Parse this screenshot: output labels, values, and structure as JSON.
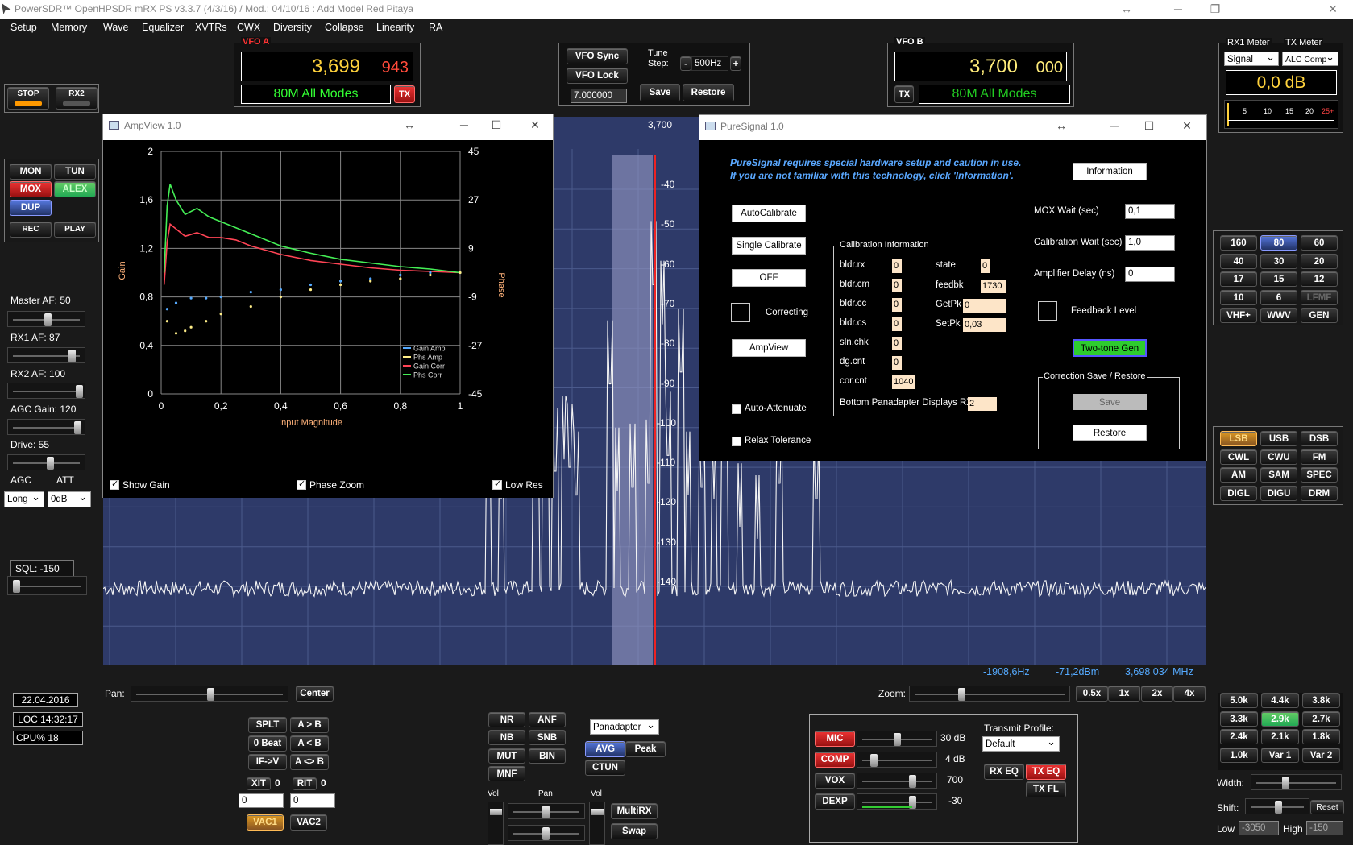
{
  "titlebar": {
    "title": "PowerSDR™ OpenHPSDR mRX PS v3.3.7 (4/3/16) / Mod.: 04/10/16 : Add Model Red Pitaya",
    "resize_glyph": "↔"
  },
  "menu": [
    "Setup",
    "Memory",
    "Wave",
    "Equalizer",
    "XVTRs",
    "CWX",
    "Diversity",
    "Collapse",
    "Linearity",
    "RA"
  ],
  "power": {
    "stop": "STOP",
    "rx2": "RX2"
  },
  "modebtns": {
    "mon": "MON",
    "tun": "TUN",
    "mox": "MOX",
    "alex": "ALEX",
    "dup": "DUP",
    "rec": "REC",
    "play": "PLAY"
  },
  "vfo_a": {
    "label": "VFO A",
    "freq_main": "3,699",
    "freq_sub": "943",
    "band": "80M All Modes",
    "tx": "TX"
  },
  "vfo_b": {
    "label": "VFO B",
    "freq_main": "3,700",
    "freq_sub": "000",
    "band": "80M All Modes",
    "tx": "TX"
  },
  "vfo_ctl": {
    "sync": "VFO Sync",
    "lock": "VFO Lock",
    "tune_step_label": "Tune Step:",
    "tune_step": "500Hz",
    "minus": "-",
    "plus": "+",
    "freq_box": "7.000000",
    "save": "Save",
    "restore": "Restore"
  },
  "meters": {
    "rx1_label": "RX1 Meter",
    "tx_label": "TX Meter",
    "rx1_sel": "Signal",
    "tx_sel": "ALC Comp",
    "reading": "0,0 dB",
    "scale": [
      "5",
      "10",
      "15",
      "20",
      "25+"
    ]
  },
  "left": {
    "master_af": "Master AF:  50",
    "rx1_af": "RX1 AF:  87",
    "rx2_af": "RX2 AF:  100",
    "agc_gain": "AGC Gain:  120",
    "drive": "Drive:  55",
    "agc": "AGC",
    "att": "ATT",
    "agc_sel": "Long",
    "att_sel": "0dB",
    "sql": "SQL: -150"
  },
  "status": {
    "date": "22.04.2016",
    "loc": "LOC 14:32:17",
    "cpu": "CPU%  18"
  },
  "bands": [
    "160",
    "80",
    "60",
    "40",
    "30",
    "20",
    "17",
    "15",
    "12",
    "10",
    "6",
    "LFMF",
    "VHF+",
    "WWV",
    "GEN"
  ],
  "modes": [
    "LSB",
    "USB",
    "DSB",
    "CWL",
    "CWU",
    "FM",
    "AM",
    "SAM",
    "SPEC",
    "DIGL",
    "DIGU",
    "DRM"
  ],
  "filters": [
    "5.0k",
    "4.4k",
    "3.8k",
    "3.3k",
    "2.9k",
    "2.7k",
    "2.4k",
    "2.1k",
    "1.8k",
    "1.0k",
    "Var 1",
    "Var 2"
  ],
  "filter_ctl": {
    "width": "Width:",
    "shift": "Shift:",
    "reset": "Reset",
    "low": "Low",
    "low_val": "-3050",
    "high": "High",
    "high_val": "-150"
  },
  "display": {
    "center_freq": "3,700",
    "dbm_labels": [
      "-40",
      "-50",
      "-60",
      "-70",
      "-80",
      "-90",
      "-100",
      "-110",
      "-120",
      "-130",
      "-140"
    ],
    "cursor_hz": "-1908,6Hz",
    "cursor_dbm": "-71,2dBm",
    "cursor_mhz": "3,698 034 MHz"
  },
  "pan": {
    "pan": "Pan:",
    "center": "Center",
    "zoom": "Zoom:",
    "z05": "0.5x",
    "z1": "1x",
    "z2": "2x",
    "z4": "4x"
  },
  "vfo_btns": {
    "splt": "SPLT",
    "atob": "A > B",
    "zerobeat": "0 Beat",
    "btoa": "A < B",
    "ifv": "IF->V",
    "swap": "A <> B",
    "xit": "XIT",
    "xit_v": "0",
    "rit": "RIT",
    "rit_v": "0",
    "xit_num": "0",
    "rit_num": "0",
    "vac1": "VAC1",
    "vac2": "VAC2"
  },
  "dsp": {
    "nr": "NR",
    "anf": "ANF",
    "nb": "NB",
    "snb": "SNB",
    "mut": "MUT",
    "bin": "BIN",
    "mnf": "MNF",
    "display_mode": "Panadapter",
    "avg": "AVG",
    "peak": "Peak",
    "ctun": "CTUN",
    "vol": "Vol",
    "pan": "Pan",
    "vol2": "Vol",
    "multirx": "MultiRX",
    "swap": "Swap"
  },
  "tx": {
    "mic": "MIC",
    "mic_val": "30 dB",
    "comp": "COMP",
    "comp_val": "4 dB",
    "vox": "VOX",
    "vox_val": "700",
    "dexp": "DEXP",
    "dexp_val": "-30",
    "profile_label": "Transmit Profile:",
    "profile": "Default",
    "rxeq": "RX EQ",
    "txeq": "TX EQ",
    "txfl": "TX FL"
  },
  "ampview": {
    "title": "AmpView 1.0",
    "yleft": [
      "2",
      "1,6",
      "1,2",
      "0,8",
      "0,4",
      "0"
    ],
    "yright": [
      "45",
      "27",
      "9",
      "-9",
      "-27",
      "-45"
    ],
    "xticks": [
      "0",
      "0,2",
      "0,4",
      "0,6",
      "0,8",
      "1"
    ],
    "ylabel": "Gain",
    "y2label": "Phase",
    "xlabel": "Input Magnitude",
    "legend": [
      "Gain Amp",
      "Phs Amp",
      "Gain Corr",
      "Phs Corr"
    ],
    "show_gain": "Show Gain",
    "phase_zoom": "Phase Zoom",
    "low_res": "Low Res"
  },
  "chart_data": {
    "type": "line",
    "x_range": [
      0,
      1
    ],
    "y_range": [
      0,
      2
    ],
    "y2_range": [
      -45,
      45
    ],
    "series": [
      {
        "name": "Gain Corr",
        "color": "#ff4455",
        "x": [
          0.01,
          0.02,
          0.03,
          0.05,
          0.08,
          0.12,
          0.16,
          0.2,
          0.25,
          0.3,
          0.4,
          0.5,
          0.6,
          0.7,
          0.8,
          0.9,
          1.0
        ],
        "y": [
          0.9,
          1.25,
          1.4,
          1.36,
          1.3,
          1.33,
          1.29,
          1.29,
          1.27,
          1.22,
          1.15,
          1.1,
          1.07,
          1.04,
          1.02,
          1.01,
          1.0
        ]
      },
      {
        "name": "Phs Corr",
        "color": "#44ee55",
        "x": [
          0.01,
          0.02,
          0.03,
          0.05,
          0.08,
          0.12,
          0.16,
          0.2,
          0.25,
          0.3,
          0.4,
          0.5,
          0.6,
          0.7,
          0.8,
          0.9,
          1.0
        ],
        "y": [
          1.0,
          1.55,
          1.73,
          1.6,
          1.48,
          1.53,
          1.46,
          1.42,
          1.37,
          1.32,
          1.22,
          1.16,
          1.11,
          1.08,
          1.05,
          1.03,
          1.0
        ]
      },
      {
        "name": "Gain Amp",
        "color": "#55aaff",
        "x": [
          0.02,
          0.05,
          0.1,
          0.15,
          0.2,
          0.3,
          0.4,
          0.5,
          0.6,
          0.7,
          0.8,
          0.9,
          1.0
        ],
        "y": [
          0.7,
          0.75,
          0.79,
          0.79,
          0.8,
          0.84,
          0.86,
          0.9,
          0.93,
          0.95,
          0.98,
          1.0,
          1.0
        ]
      },
      {
        "name": "Phs Amp",
        "color": "#ffee88",
        "x": [
          0.02,
          0.05,
          0.08,
          0.1,
          0.15,
          0.2,
          0.3,
          0.4,
          0.5,
          0.6,
          0.7,
          0.8,
          0.9,
          1.0
        ],
        "y": [
          0.6,
          0.5,
          0.52,
          0.55,
          0.6,
          0.66,
          0.72,
          0.8,
          0.86,
          0.9,
          0.93,
          0.95,
          0.98,
          1.0
        ]
      }
    ]
  },
  "puresignal": {
    "title": "PureSignal 1.0",
    "warn1": "PureSignal requires special hardware setup and caution in use.",
    "warn2": "If you are not familiar with this technology, click 'Information'.",
    "information": "Information",
    "autocal": "AutoCalibrate",
    "single": "Single Calibrate",
    "off": "OFF",
    "correcting": "Correcting",
    "ampview": "AmpView",
    "auto_att": "Auto-Attenuate",
    "relax": "Relax Tolerance",
    "calinfo": "Calibration Information",
    "cal": [
      {
        "l": "bldr.rx",
        "v": "0"
      },
      {
        "l": "bldr.cm",
        "v": "0"
      },
      {
        "l": "bldr.cc",
        "v": "0"
      },
      {
        "l": "bldr.cs",
        "v": "0"
      },
      {
        "l": "sln.chk",
        "v": "0"
      },
      {
        "l": "dg.cnt",
        "v": "0"
      },
      {
        "l": "cor.cnt",
        "v": "1040"
      }
    ],
    "state_l": "state",
    "state_v": "0",
    "feedbk_l": "feedbk",
    "feedbk_v": "1730",
    "getpk_l": "GetPk",
    "getpk_v": "0",
    "setpk_l": "SetPk",
    "setpk_v": "0,03",
    "bottom_pan": "Bottom Panadapter Displays RX",
    "bottom_pan_v": "2",
    "mox_wait": "MOX Wait (sec)",
    "mox_wait_v": "0,1",
    "cal_wait": "Calibration Wait (sec)",
    "cal_wait_v": "1,0",
    "amp_delay": "Amplifier Delay (ns)",
    "amp_delay_v": "0",
    "feedback": "Feedback Level",
    "twotone": "Two-tone Gen",
    "save_group": "Correction Save / Restore",
    "save": "Save",
    "restore": "Restore"
  }
}
